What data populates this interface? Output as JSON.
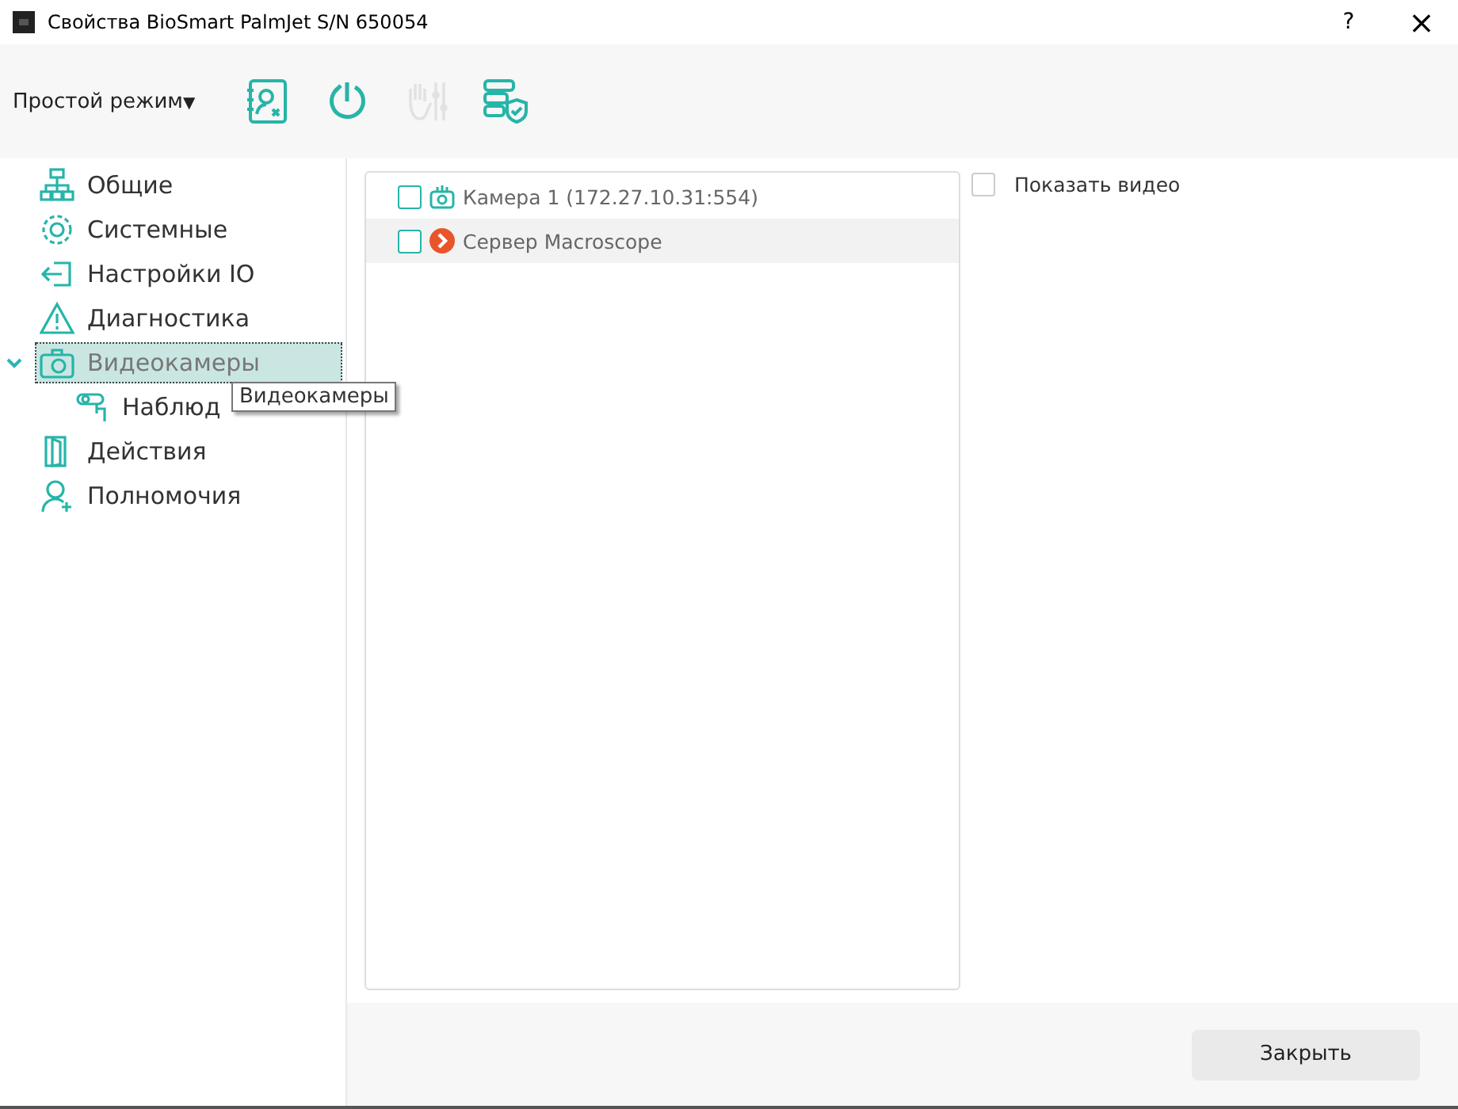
{
  "window": {
    "title": "Свойства BioSmart PalmJet S/N 650054",
    "help": "?",
    "close": "×"
  },
  "toolbar": {
    "mode": "Простой режим",
    "mode_caret": "▼",
    "tools": [
      {
        "kind": "contacts",
        "disabled": false
      },
      {
        "kind": "power",
        "disabled": false
      },
      {
        "kind": "hand",
        "disabled": true
      },
      {
        "kind": "servers",
        "disabled": false
      }
    ]
  },
  "sidebar": {
    "items": [
      {
        "label": "Общие",
        "kind": "network",
        "selected": false
      },
      {
        "label": "Системные",
        "kind": "gear",
        "selected": false
      },
      {
        "label": "Настройки IO",
        "kind": "login",
        "selected": false
      },
      {
        "label": "Диагностика",
        "kind": "warning",
        "selected": false
      },
      {
        "label": "Видеокамеры",
        "kind": "camera",
        "selected": true,
        "expanded": true,
        "children": [
          {
            "label": "Наблюд",
            "kind": "cctv",
            "selected": false
          }
        ]
      },
      {
        "label": "Действия",
        "kind": "door",
        "selected": false
      },
      {
        "label": "Полномочия",
        "kind": "user",
        "selected": false
      }
    ]
  },
  "tooltip": "Видеокамеры",
  "device_list": [
    {
      "label": "Камера 1 (172.27.10.31:554)",
      "kind": "camera",
      "checked": false,
      "highlighted": false
    },
    {
      "label": "Сервер Macroscope",
      "kind": "server",
      "checked": false,
      "highlighted": true
    }
  ],
  "show_video": {
    "label": "Показать видео",
    "checked": false
  },
  "buttons": [
    "Закрыть"
  ]
}
